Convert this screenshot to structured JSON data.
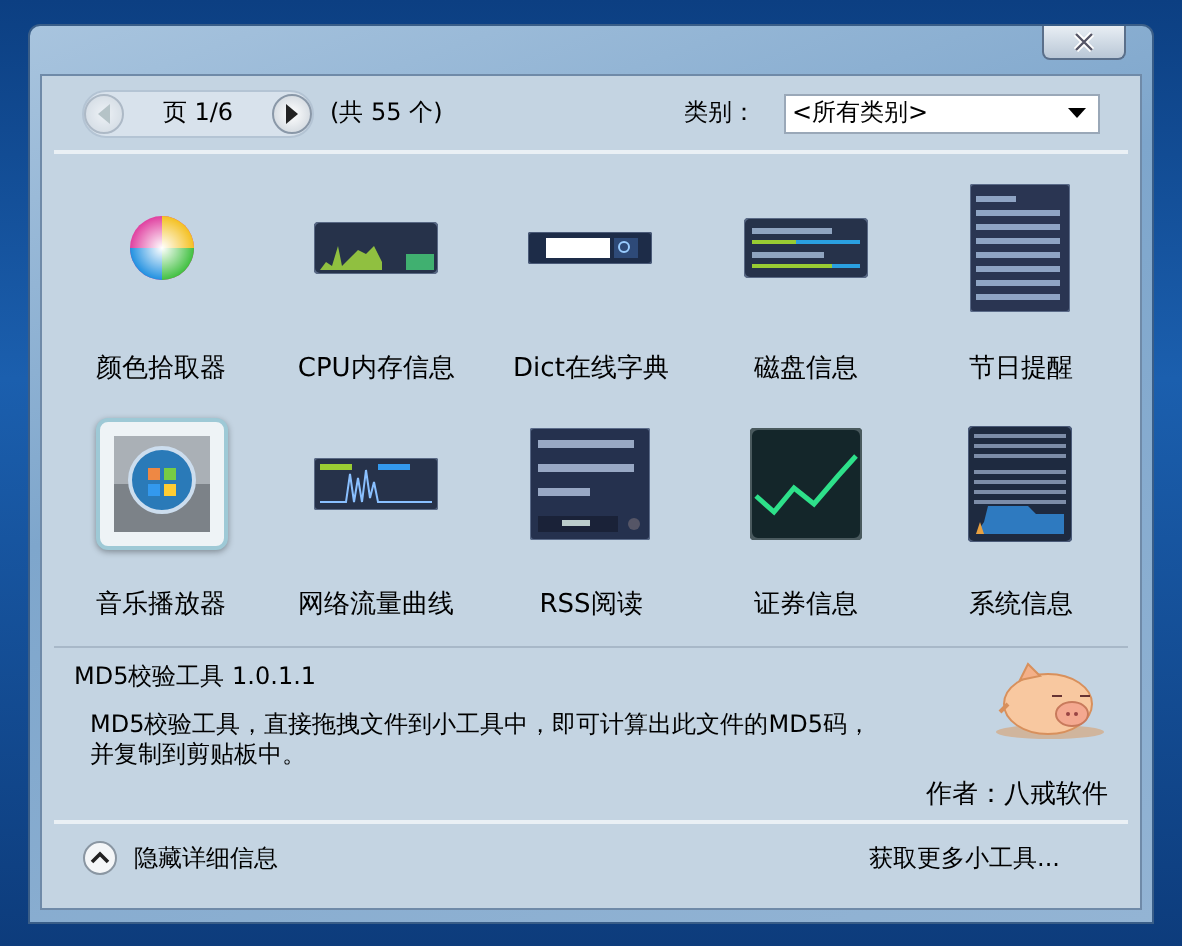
{
  "pager": {
    "page": "页 1/6",
    "total": "(共 55 个)"
  },
  "category": {
    "label": "类别：",
    "value": "<所有类别>"
  },
  "gadgets": [
    {
      "name": "颜色拾取器",
      "kind": "color-wheel",
      "selected": false
    },
    {
      "name": "CPU内存信息",
      "kind": "cpu-graph",
      "selected": false
    },
    {
      "name": "Dict在线字典",
      "kind": "dict-search",
      "selected": false
    },
    {
      "name": "磁盘信息",
      "kind": "disk-bars",
      "selected": false
    },
    {
      "name": "节日提醒",
      "kind": "holiday-list",
      "selected": false
    },
    {
      "name": "音乐播放器",
      "kind": "media-player",
      "selected": true
    },
    {
      "name": "网络流量曲线",
      "kind": "net-graph",
      "selected": false
    },
    {
      "name": "RSS阅读",
      "kind": "rss-list",
      "selected": false
    },
    {
      "name": "证券信息",
      "kind": "stock-chart",
      "selected": false
    },
    {
      "name": "系统信息",
      "kind": "system-info",
      "selected": false
    }
  ],
  "details": {
    "title": "MD5校验工具 1.0.1.1",
    "description": "MD5校验工具，直接拖拽文件到小工具中，即可计算出此文件的MD5码，并复制到剪贴板中。",
    "author": "作者：八戒软件"
  },
  "footer": {
    "toggle": "隐藏详细信息",
    "more": "获取更多小工具..."
  }
}
